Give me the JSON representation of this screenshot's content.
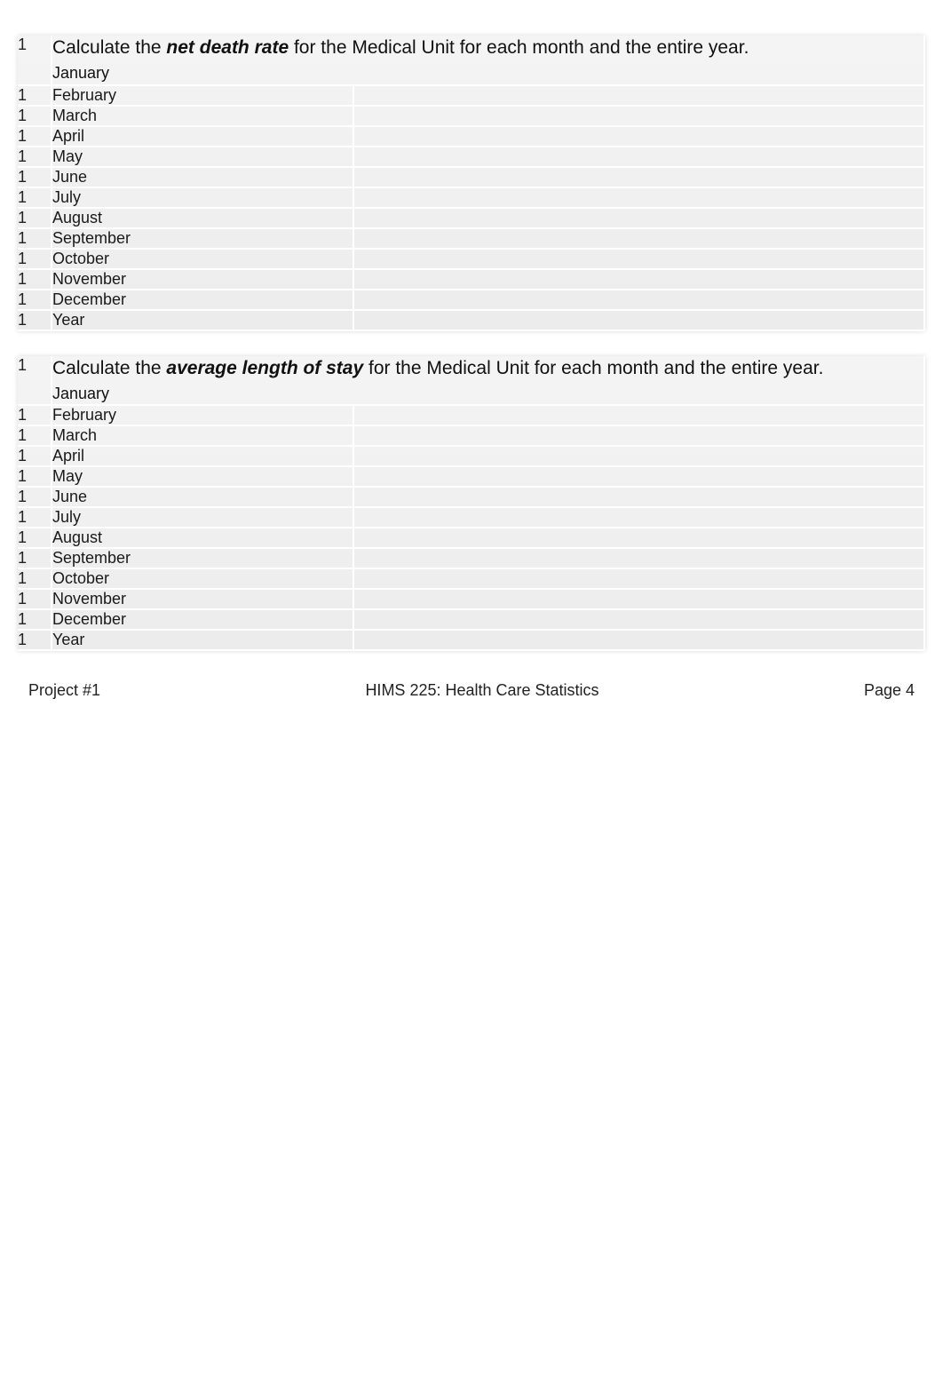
{
  "sections": [
    {
      "prompt_pre": "Calculate the ",
      "prompt_bold": "net death rate",
      "prompt_post": " for the Medical Unit for each month and the entire year.",
      "rows": [
        {
          "num": "1",
          "label": "January",
          "value": ""
        },
        {
          "num": "1",
          "label": "February",
          "value": ""
        },
        {
          "num": "1",
          "label": "March",
          "value": ""
        },
        {
          "num": "1",
          "label": "April",
          "value": ""
        },
        {
          "num": "1",
          "label": "May",
          "value": ""
        },
        {
          "num": "1",
          "label": "June",
          "value": ""
        },
        {
          "num": "1",
          "label": "July",
          "value": ""
        },
        {
          "num": "1",
          "label": "August",
          "value": ""
        },
        {
          "num": "1",
          "label": "September",
          "value": ""
        },
        {
          "num": "1",
          "label": "October",
          "value": ""
        },
        {
          "num": "1",
          "label": "November",
          "value": ""
        },
        {
          "num": "1",
          "label": "December",
          "value": ""
        },
        {
          "num": "1",
          "label": "Year",
          "value": ""
        }
      ]
    },
    {
      "prompt_pre": "Calculate the ",
      "prompt_bold": "average length of stay",
      "prompt_post": " for the Medical Unit for each month and the entire year.",
      "rows": [
        {
          "num": "1",
          "label": "January",
          "value": ""
        },
        {
          "num": "1",
          "label": "February",
          "value": ""
        },
        {
          "num": "1",
          "label": "March",
          "value": ""
        },
        {
          "num": "1",
          "label": "April",
          "value": ""
        },
        {
          "num": "1",
          "label": "May",
          "value": ""
        },
        {
          "num": "1",
          "label": "June",
          "value": ""
        },
        {
          "num": "1",
          "label": "July",
          "value": ""
        },
        {
          "num": "1",
          "label": "August",
          "value": ""
        },
        {
          "num": "1",
          "label": "September",
          "value": ""
        },
        {
          "num": "1",
          "label": "October",
          "value": ""
        },
        {
          "num": "1",
          "label": "November",
          "value": ""
        },
        {
          "num": "1",
          "label": "December",
          "value": ""
        },
        {
          "num": "1",
          "label": "Year",
          "value": ""
        }
      ]
    }
  ],
  "footer": {
    "left": "Project #1",
    "center": "HIMS 225:  Health Care Statistics",
    "right": "Page 4"
  }
}
